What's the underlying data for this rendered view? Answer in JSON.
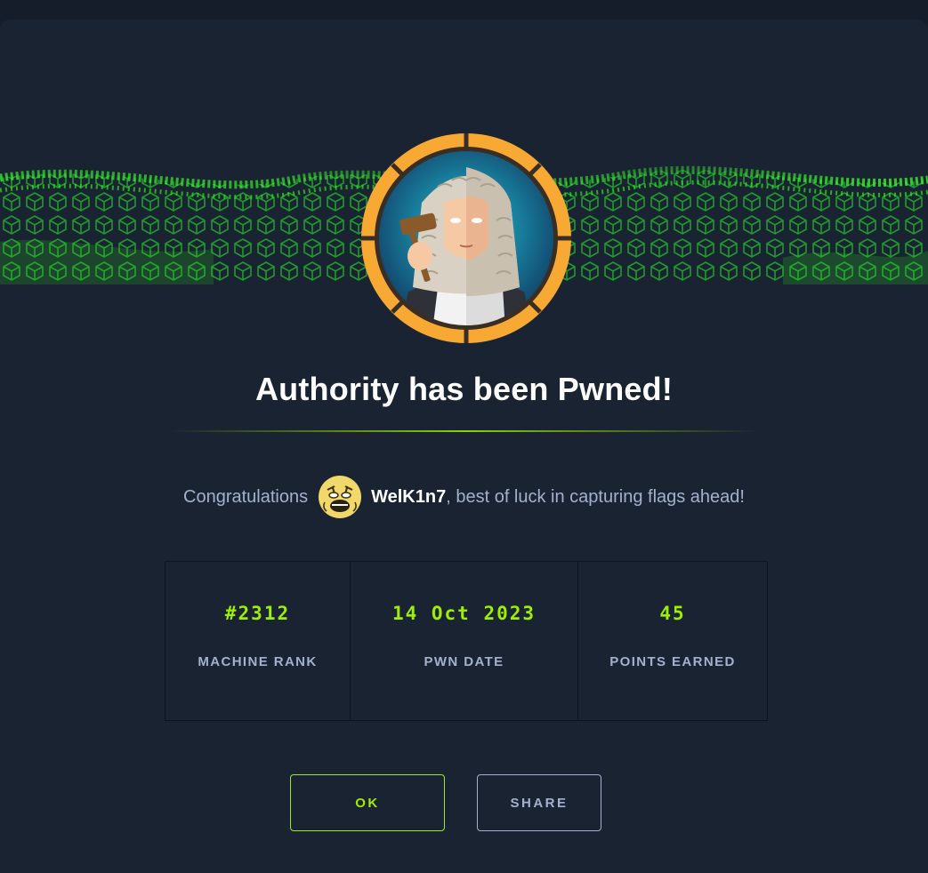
{
  "dialog": {
    "title": "Authority has been Pwned!",
    "congrats": {
      "prefix": "Congratulations",
      "username": "WelK1n7",
      "suffix": ", best of luck in capturing flags ahead!"
    },
    "stats": [
      {
        "value": "#2312",
        "label": "MACHINE RANK"
      },
      {
        "value": "14 Oct 2023",
        "label": "PWN DATE"
      },
      {
        "value": "45",
        "label": "POINTS EARNED"
      }
    ],
    "buttons": {
      "ok": "OK",
      "share": "SHARE"
    }
  },
  "icons": {
    "badge": "machine-badge-judge-icon",
    "avatar": "user-avatar-icon"
  },
  "colors": {
    "accent": "#9fef00",
    "badge_ring": "#f7a934",
    "background": "#1a2332",
    "text_muted": "#a4b1cd"
  }
}
